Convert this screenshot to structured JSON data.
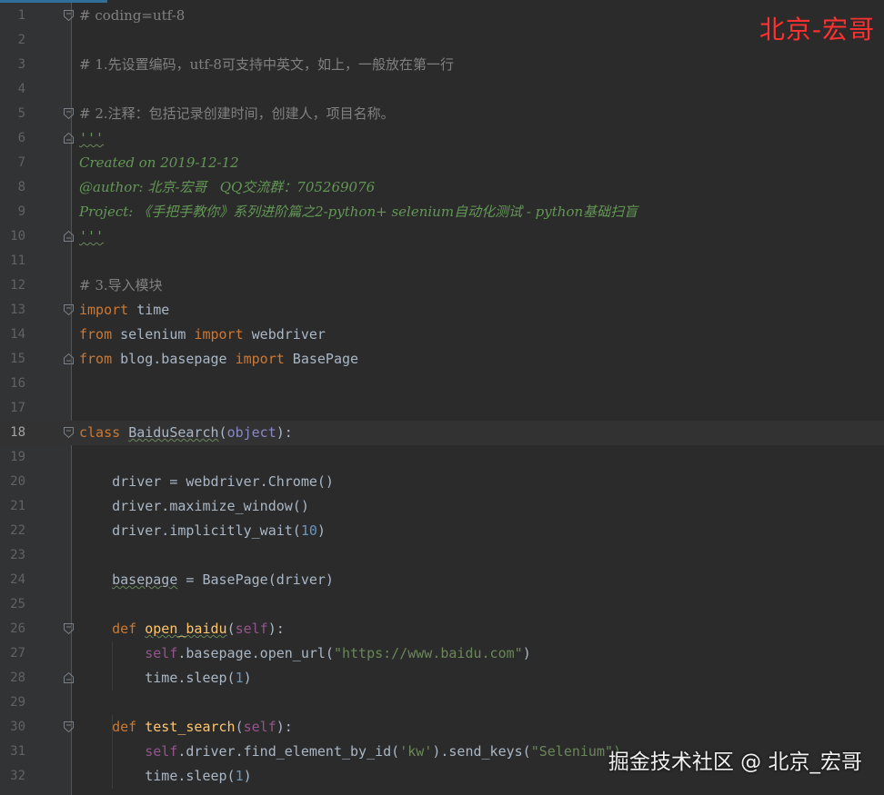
{
  "editor": {
    "lines": [
      {
        "n": "1",
        "tokens": [
          {
            "t": "# coding=utf-8",
            "c": "cm"
          }
        ],
        "fold": "open"
      },
      {
        "n": "2",
        "tokens": []
      },
      {
        "n": "3",
        "tokens": [
          {
            "t": "# 1.先设置编码，utf-8可支持中英文，如上，一般放在第一行",
            "c": "cm"
          }
        ]
      },
      {
        "n": "4",
        "tokens": []
      },
      {
        "n": "5",
        "tokens": [
          {
            "t": "# 2.注释：包括记录创建时间，创建人，项目名称。",
            "c": "cm"
          }
        ],
        "fold": "open"
      },
      {
        "n": "6",
        "tokens": [
          {
            "t": "'''",
            "c": "doc2 uw"
          }
        ],
        "fold": "close"
      },
      {
        "n": "7",
        "tokens": [
          {
            "t": "Created on 2019-12-12",
            "c": "doc"
          }
        ]
      },
      {
        "n": "8",
        "tokens": [
          {
            "t": "@author: 北京-宏哥   QQ交流群：705269076",
            "c": "doc"
          }
        ]
      },
      {
        "n": "9",
        "tokens": [
          {
            "t": "Project: 《手把手教你》系列进阶篇之2-python+ selenium自动化测试 - python基础扫盲",
            "c": "doc"
          }
        ]
      },
      {
        "n": "10",
        "tokens": [
          {
            "t": "'''",
            "c": "doc2 uw"
          }
        ],
        "fold": "close"
      },
      {
        "n": "11",
        "tokens": []
      },
      {
        "n": "12",
        "tokens": [
          {
            "t": "# 3.导入模块",
            "c": "cm"
          }
        ]
      },
      {
        "n": "13",
        "tokens": [
          {
            "t": "import",
            "c": "kw"
          },
          {
            "t": " time",
            "c": ""
          }
        ],
        "fold": "open"
      },
      {
        "n": "14",
        "tokens": [
          {
            "t": "from",
            "c": "kw"
          },
          {
            "t": " selenium ",
            "c": ""
          },
          {
            "t": "import",
            "c": "kw"
          },
          {
            "t": " webdriver",
            "c": ""
          }
        ]
      },
      {
        "n": "15",
        "tokens": [
          {
            "t": "from",
            "c": "kw"
          },
          {
            "t": " blog.basepage ",
            "c": ""
          },
          {
            "t": "import",
            "c": "kw"
          },
          {
            "t": " BasePage",
            "c": ""
          }
        ],
        "fold": "close"
      },
      {
        "n": "16",
        "tokens": []
      },
      {
        "n": "17",
        "tokens": []
      },
      {
        "n": "18",
        "tokens": [
          {
            "t": "class",
            "c": "kw"
          },
          {
            "t": " ",
            "c": ""
          },
          {
            "t": "BaiduSearch",
            "c": "uw"
          },
          {
            "t": "(",
            "c": ""
          },
          {
            "t": "object",
            "c": "obj"
          },
          {
            "t": "):",
            "c": ""
          }
        ],
        "fold": "open",
        "current": true
      },
      {
        "n": "19",
        "tokens": []
      },
      {
        "n": "20",
        "tokens": [
          {
            "t": "    driver = webdriver.Chrome()",
            "c": ""
          }
        ]
      },
      {
        "n": "21",
        "tokens": [
          {
            "t": "    driver.maximize_window()",
            "c": ""
          }
        ]
      },
      {
        "n": "22",
        "tokens": [
          {
            "t": "    driver.implicitly_wait(",
            "c": ""
          },
          {
            "t": "10",
            "c": "num"
          },
          {
            "t": ")",
            "c": ""
          }
        ]
      },
      {
        "n": "23",
        "tokens": []
      },
      {
        "n": "24",
        "tokens": [
          {
            "t": "    ",
            "c": ""
          },
          {
            "t": "basepage",
            "c": "uw"
          },
          {
            "t": " = BasePage(driver)",
            "c": ""
          }
        ]
      },
      {
        "n": "25",
        "tokens": []
      },
      {
        "n": "26",
        "tokens": [
          {
            "t": "    ",
            "c": ""
          },
          {
            "t": "def",
            "c": "kw"
          },
          {
            "t": " ",
            "c": ""
          },
          {
            "t": "open_baidu",
            "c": "fn uw"
          },
          {
            "t": "(",
            "c": ""
          },
          {
            "t": "self",
            "c": "slf"
          },
          {
            "t": "):",
            "c": ""
          }
        ],
        "fold": "open"
      },
      {
        "n": "27",
        "tokens": [
          {
            "t": "        ",
            "c": ""
          },
          {
            "t": "self",
            "c": "slf"
          },
          {
            "t": ".basepage.open_url(",
            "c": ""
          },
          {
            "t": "\"https://www.baidu.com\"",
            "c": "str"
          },
          {
            "t": ")",
            "c": ""
          }
        ]
      },
      {
        "n": "28",
        "tokens": [
          {
            "t": "        time.sleep(",
            "c": ""
          },
          {
            "t": "1",
            "c": "num"
          },
          {
            "t": ")",
            "c": ""
          }
        ],
        "fold": "close"
      },
      {
        "n": "29",
        "tokens": []
      },
      {
        "n": "30",
        "tokens": [
          {
            "t": "    ",
            "c": ""
          },
          {
            "t": "def",
            "c": "kw"
          },
          {
            "t": " ",
            "c": ""
          },
          {
            "t": "test_search",
            "c": "fn"
          },
          {
            "t": "(",
            "c": ""
          },
          {
            "t": "self",
            "c": "slf"
          },
          {
            "t": "):",
            "c": ""
          }
        ],
        "fold": "open"
      },
      {
        "n": "31",
        "tokens": [
          {
            "t": "        ",
            "c": ""
          },
          {
            "t": "self",
            "c": "slf"
          },
          {
            "t": ".driver.find_element_by_id(",
            "c": ""
          },
          {
            "t": "'kw'",
            "c": "str"
          },
          {
            "t": ").send_keys(",
            "c": ""
          },
          {
            "t": "\"Selenium\")",
            "c": "str"
          }
        ]
      },
      {
        "n": "32",
        "tokens": [
          {
            "t": "        time.sleep(",
            "c": ""
          },
          {
            "t": "1",
            "c": "num"
          },
          {
            "t": ")",
            "c": ""
          }
        ]
      }
    ]
  },
  "watermarks": {
    "top_right": "北京-宏哥",
    "bottom_right": "掘金技术社区 @ 北京_宏哥"
  },
  "colors": {
    "background": "#2b2b2b",
    "gutter": "#313335",
    "keyword": "#cc7832",
    "comment": "#808080",
    "docstring": "#629755",
    "string": "#6a8759",
    "number": "#6897bb",
    "self": "#94558d",
    "function": "#ffc66d",
    "watermark_red": "#ff3030"
  }
}
